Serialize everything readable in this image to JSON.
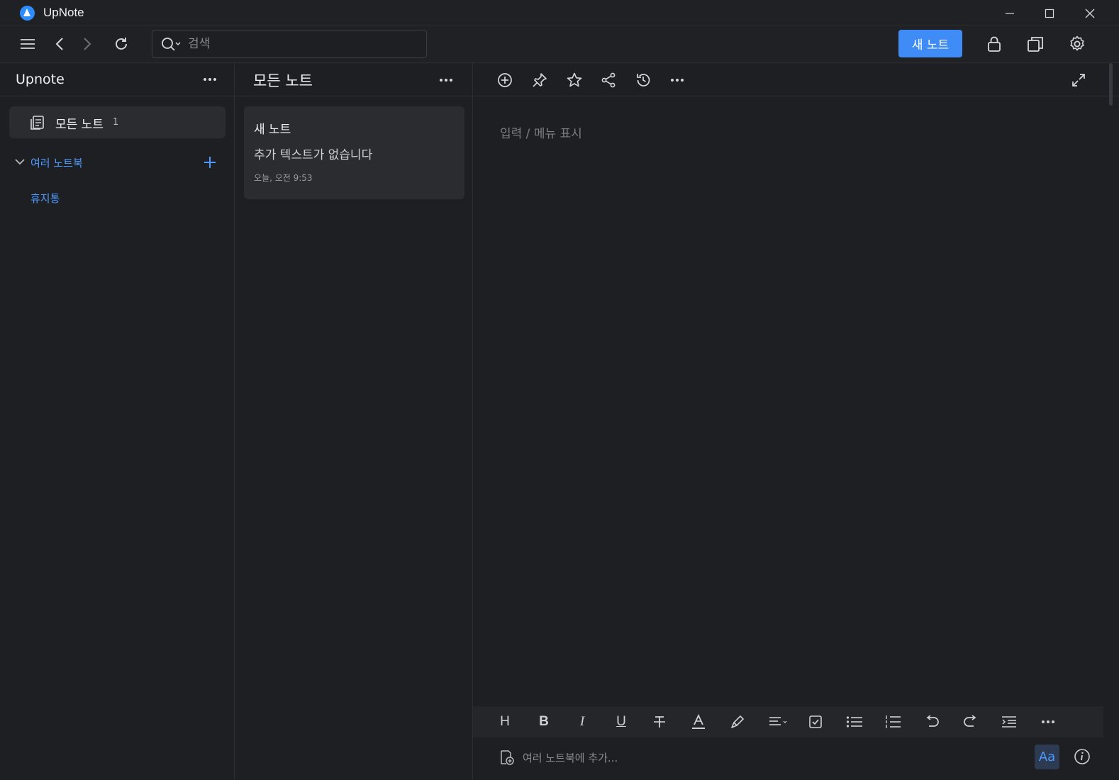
{
  "window": {
    "title": "UpNote"
  },
  "toolbar": {
    "search_placeholder": "검색",
    "new_note_label": "새 노트"
  },
  "sidebar": {
    "title": "Upnote",
    "all_notes": {
      "label": "모든 노트",
      "count": "1"
    },
    "notebooks_label": "여러 노트북",
    "trash_label": "휴지통"
  },
  "notelist": {
    "title": "모든 노트",
    "notes": [
      {
        "title": "새 노트",
        "preview": "추가 텍스트가 없습니다",
        "date": "오늘, 오전 9:53"
      }
    ]
  },
  "editor": {
    "placeholder": "입력 / 메뉴 표시",
    "add_to_notebook_placeholder": "여러 노트북에 추가...",
    "font_button_label": "Aa",
    "format_buttons": [
      "H",
      "B",
      "I",
      "U"
    ]
  },
  "colors": {
    "accent": "#3f8cf7",
    "link": "#4e9bff",
    "background": "#1e1f22",
    "panel": "#2b2c30"
  }
}
